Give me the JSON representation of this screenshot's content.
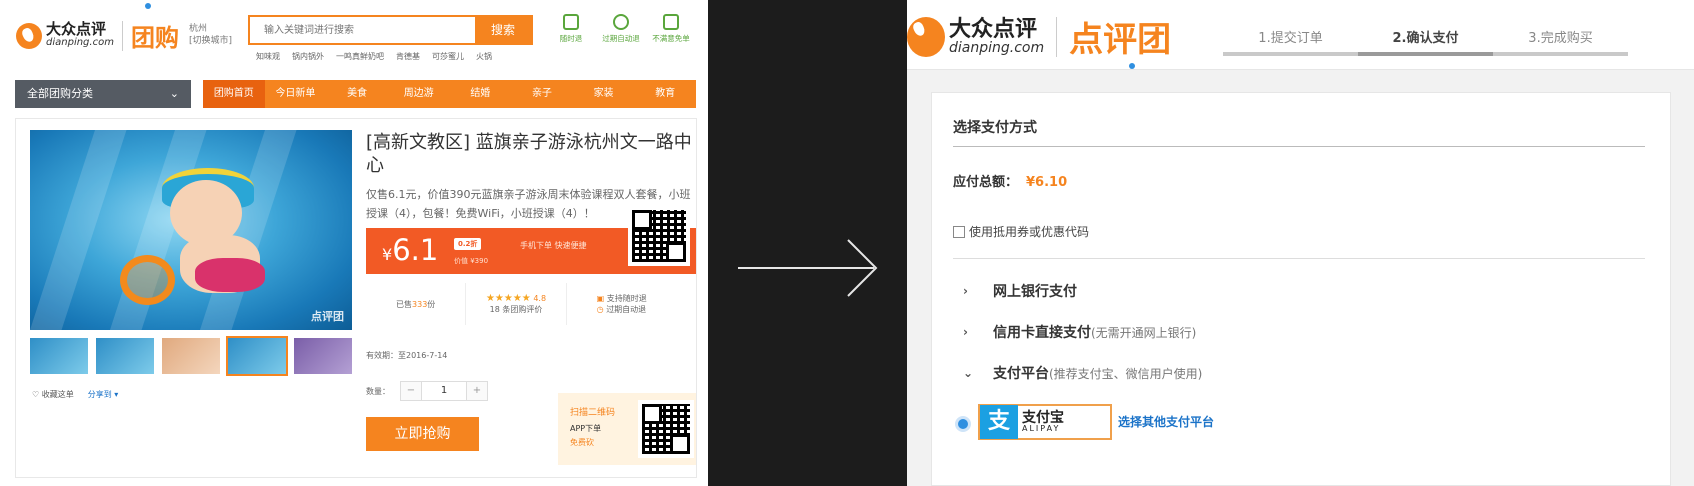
{
  "left": {
    "logo": {
      "cn": "大众点评",
      "en": "dianping.com",
      "brand": "团购"
    },
    "city": {
      "name": "杭州",
      "switch": "[切换城市]"
    },
    "search": {
      "placeholder": "输入关键词进行搜索",
      "button": "搜索"
    },
    "hot_words": [
      "知味观",
      "锅内锅外",
      "一鸣真鲜奶吧",
      "肯德基",
      "可莎蜜儿",
      "火锅"
    ],
    "top_icons": [
      {
        "label": "随时退",
        "icon": "refund-anytime-icon"
      },
      {
        "label": "过期自动退",
        "icon": "alarm-clock-icon"
      },
      {
        "label": "不满意免单",
        "icon": "satisfaction-icon"
      }
    ],
    "category_button": "全部团购分类",
    "nav": [
      "团购首页",
      "今日新单",
      "美食",
      "周边游",
      "结婚",
      "亲子",
      "家装",
      "教育"
    ],
    "deal": {
      "title": "[高新文教区] 蓝旗亲子游泳杭州文一路中心",
      "description": "仅售6.1元，价值390元蓝旗亲子游泳周末体验课程双人套餐，小班授课（4），包餐！免费WiFi，小班授课（4）！",
      "watermark": "点评团",
      "price_symbol": "¥",
      "price": "6.1",
      "discount": "0.2折",
      "original_price": "价值 ¥390",
      "mobile_note": "手机下单 快速便捷",
      "sold": {
        "prefix": "已售",
        "count": "333",
        "suffix": "份"
      },
      "rating": {
        "stars": "★★★★★",
        "score": "4.8",
        "reviews": "18 条团购评价"
      },
      "features": [
        "支持随时退",
        "过期自动退"
      ],
      "valid": "有效期：至2016-7-14",
      "quantity_label": "数量：",
      "quantity": "1",
      "buy_button": "立即抢购",
      "favorite": "收藏这单",
      "share": "分享到 ▾",
      "app": {
        "scan": "扫描二维码",
        "download": "APP下单",
        "free": "免费砍"
      }
    }
  },
  "right": {
    "logo": {
      "cn": "大众点评",
      "en": "dianping.com",
      "brand": "点评团"
    },
    "steps": [
      "1.提交订单",
      "2.确认支付",
      "3.完成购买"
    ],
    "active_step": 1,
    "section_title": "选择支付方式",
    "total_label": "应付总额：",
    "total_amount": "¥6.10",
    "coupon_label": "使用抵用券或优惠代码",
    "options": [
      {
        "label": "网上银行支付",
        "sub": "",
        "chevron": "›"
      },
      {
        "label": "信用卡直接支付",
        "sub": "(无需开通网上银行)",
        "chevron": "›"
      },
      {
        "label": "支付平台",
        "sub": "(推荐支付宝、微信用户使用)",
        "chevron": "⌄"
      }
    ],
    "alipay": {
      "mark": "支",
      "cn": "支付宝",
      "en": "ALIPAY"
    },
    "other_platform": "选择其他支付平台"
  },
  "colors": {
    "accent": "#f5841f",
    "price_bar": "#f25a25",
    "link": "#1b73c8",
    "radio": "#2f8fe0"
  }
}
